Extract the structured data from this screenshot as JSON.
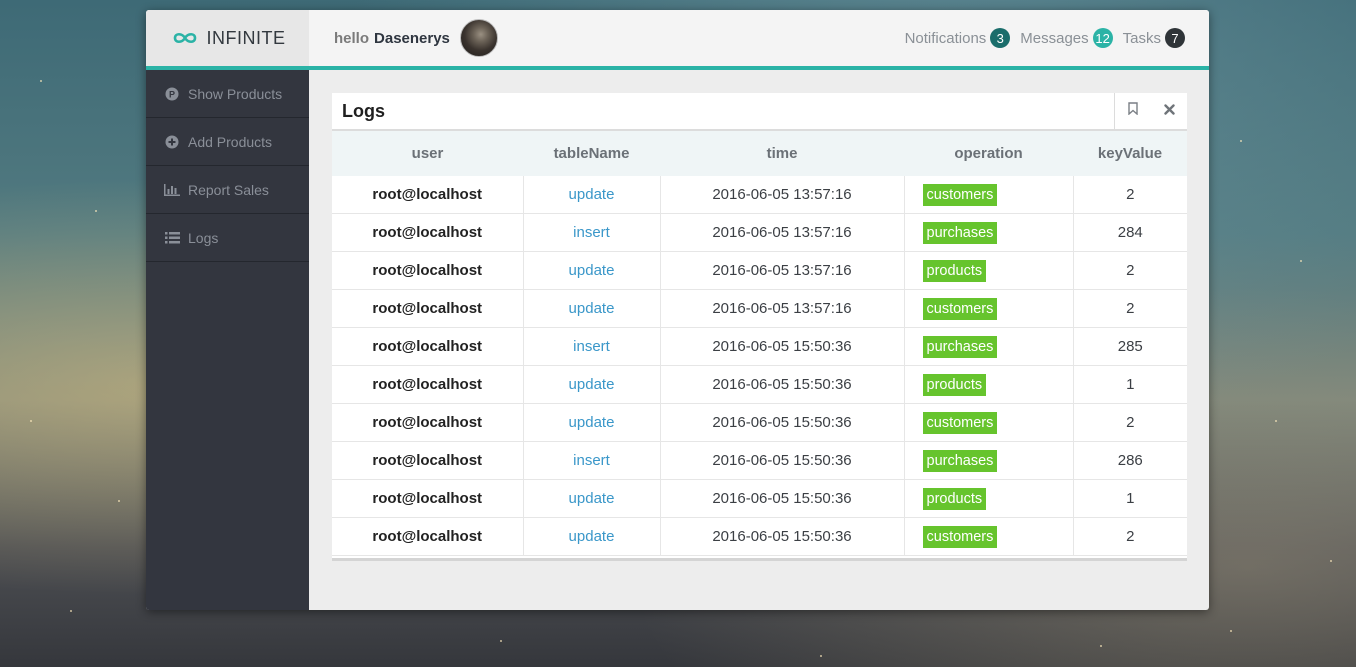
{
  "brand": {
    "name": "INFINITE"
  },
  "greeting": {
    "hello": "hello",
    "username": "Dasenerys"
  },
  "topnav": [
    {
      "label": "Notifications",
      "count": "3",
      "color": "#1a6d6b"
    },
    {
      "label": "Messages",
      "count": "12",
      "color": "#2bb3a6"
    },
    {
      "label": "Tasks",
      "count": "7",
      "color": "#2f3438"
    }
  ],
  "sidebar": {
    "items": [
      {
        "label": "Show Products",
        "icon": "circle-p-icon"
      },
      {
        "label": "Add Products",
        "icon": "plus-circle-icon"
      },
      {
        "label": "Report Sales",
        "icon": "bar-chart-icon"
      },
      {
        "label": "Logs",
        "icon": "list-icon"
      }
    ]
  },
  "panel": {
    "title": "Logs",
    "tools": [
      "bookmark-icon",
      "close-icon"
    ]
  },
  "table": {
    "columns": [
      "user",
      "tableName",
      "time",
      "operation",
      "keyValue"
    ],
    "rows": [
      [
        "root@localhost",
        "update",
        "2016-06-05 13:57:16",
        "customers",
        "2"
      ],
      [
        "root@localhost",
        "insert",
        "2016-06-05 13:57:16",
        "purchases",
        "284"
      ],
      [
        "root@localhost",
        "update",
        "2016-06-05 13:57:16",
        "products",
        "2"
      ],
      [
        "root@localhost",
        "update",
        "2016-06-05 13:57:16",
        "customers",
        "2"
      ],
      [
        "root@localhost",
        "insert",
        "2016-06-05 15:50:36",
        "purchases",
        "285"
      ],
      [
        "root@localhost",
        "update",
        "2016-06-05 15:50:36",
        "products",
        "1"
      ],
      [
        "root@localhost",
        "update",
        "2016-06-05 15:50:36",
        "customers",
        "2"
      ],
      [
        "root@localhost",
        "insert",
        "2016-06-05 15:50:36",
        "purchases",
        "286"
      ],
      [
        "root@localhost",
        "update",
        "2016-06-05 15:50:36",
        "products",
        "1"
      ],
      [
        "root@localhost",
        "update",
        "2016-06-05 15:50:36",
        "customers",
        "2"
      ]
    ]
  },
  "colors": {
    "accent": "#2bb3a6",
    "operation_label": "#66c42d",
    "link": "#3a97c9",
    "sidebar_bg": "#33363f"
  }
}
